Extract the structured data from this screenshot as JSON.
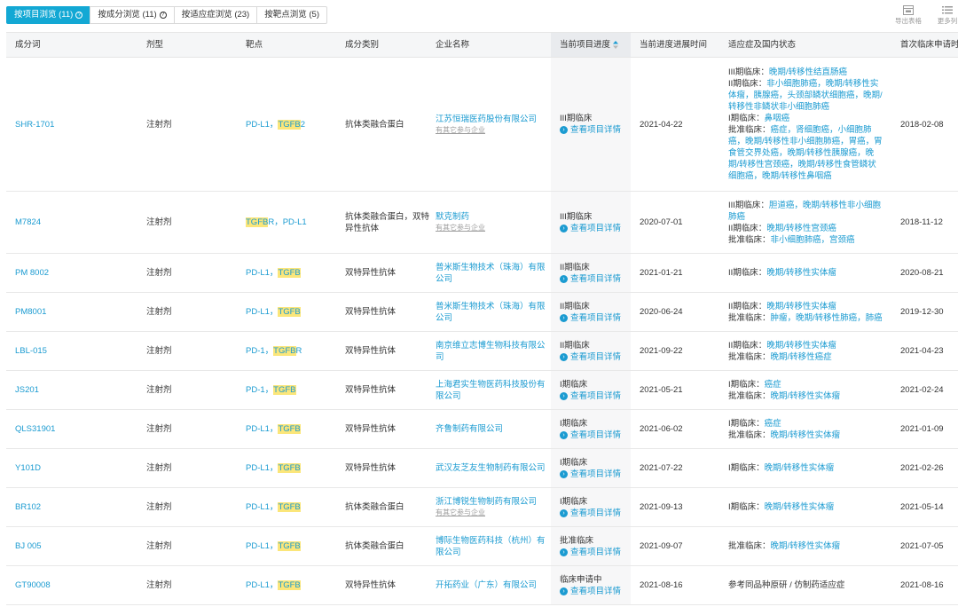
{
  "tabs": [
    {
      "label": "按项目浏览 (11)",
      "active": true,
      "help": "?"
    },
    {
      "label": "按成分浏览 (11)",
      "active": false,
      "help": "?"
    },
    {
      "label": "按适应症浏览 (23)",
      "active": false,
      "help": ""
    },
    {
      "label": "按靶点浏览 (5)",
      "active": false,
      "help": ""
    }
  ],
  "toolbar": {
    "export_label": "导出表格",
    "more_label": "更多列"
  },
  "columns": [
    "成分词",
    "剂型",
    "靶点",
    "成分类别",
    "企业名称",
    "当前项目进度",
    "当前进度进展时间",
    "适应症及国内状态",
    "首次临床申请时"
  ],
  "detail_label": "查看项目详情",
  "rows": [
    {
      "name": "SHR-1701",
      "form": "注射剂",
      "targets": [
        {
          "pre": "PD-L1，",
          "hl": "TGFB",
          "post": "2"
        }
      ],
      "category": "抗体类融合蛋白",
      "company": "江苏恒瑞医药股份有限公司",
      "company_sub": "有其它参与企业",
      "stage": "III期临床",
      "date": "2021-04-22",
      "indications": [
        {
          "label": "III期临床：",
          "value": "晚期/转移性结直肠癌"
        },
        {
          "label": "II期临床：",
          "value": "非小细胞肺癌，晚期/转移性实体瘤，胰腺癌，头颈部鳞状细胞癌，晚期/转移性非鳞状非小细胞肺癌"
        },
        {
          "label": "I期临床：",
          "value": "鼻咽癌"
        },
        {
          "label": "批准临床：",
          "value": "癌症，肾细胞癌，小细胞肺癌，晚期/转移性非小细胞肺癌，胃癌，胃食管交界处癌，晚期/转移性胰腺癌，晚期/转移性宫颈癌，晚期/转移性食管鳞状细胞癌，晚期/转移性鼻咽癌"
        }
      ],
      "first_date": "2018-02-08"
    },
    {
      "name": "M7824",
      "form": "注射剂",
      "targets": [
        {
          "pre": "",
          "hl": "TGFB",
          "post": "R，PD-L1"
        }
      ],
      "category": "抗体类融合蛋白，双特异性抗体",
      "company": "默克制药",
      "company_sub": "有其它参与企业",
      "stage": "III期临床",
      "date": "2020-07-01",
      "indications": [
        {
          "label": "III期临床：",
          "value": "胆道癌，晚期/转移性非小细胞肺癌"
        },
        {
          "label": "II期临床：",
          "value": "晚期/转移性宫颈癌"
        },
        {
          "label": "批准临床：",
          "value": "非小细胞肺癌，宫颈癌"
        }
      ],
      "first_date": "2018-11-12"
    },
    {
      "name": "PM 8002",
      "form": "注射剂",
      "targets": [
        {
          "pre": "PD-L1，",
          "hl": "TGFB",
          "post": ""
        }
      ],
      "category": "双特异性抗体",
      "company": "普米斯生物技术（珠海）有限公司",
      "company_sub": "",
      "stage": "II期临床",
      "date": "2021-01-21",
      "indications": [
        {
          "label": "II期临床：",
          "value": "晚期/转移性实体瘤"
        }
      ],
      "first_date": "2020-08-21"
    },
    {
      "name": "PM8001",
      "form": "注射剂",
      "targets": [
        {
          "pre": "PD-L1，",
          "hl": "TGFB",
          "post": ""
        }
      ],
      "category": "双特异性抗体",
      "company": "普米斯生物技术（珠海）有限公司",
      "company_sub": "",
      "stage": "II期临床",
      "date": "2020-06-24",
      "indications": [
        {
          "label": "II期临床：",
          "value": "晚期/转移性实体瘤"
        },
        {
          "label": "批准临床：",
          "value": "肿瘤，晚期/转移性肺癌，肺癌"
        }
      ],
      "first_date": "2019-12-30"
    },
    {
      "name": "LBL-015",
      "form": "注射剂",
      "targets": [
        {
          "pre": "PD-1，",
          "hl": "TGFB",
          "post": "R"
        }
      ],
      "category": "双特异性抗体",
      "company": "南京维立志博生物科技有限公司",
      "company_sub": "",
      "stage": "II期临床",
      "date": "2021-09-22",
      "indications": [
        {
          "label": "II期临床：",
          "value": "晚期/转移性实体瘤"
        },
        {
          "label": "批准临床：",
          "value": "晚期/转移性癌症"
        }
      ],
      "first_date": "2021-04-23"
    },
    {
      "name": "JS201",
      "form": "注射剂",
      "targets": [
        {
          "pre": "PD-1，",
          "hl": "TGFB",
          "post": ""
        }
      ],
      "category": "双特异性抗体",
      "company": "上海君实生物医药科技股份有限公司",
      "company_sub": "",
      "stage": "I期临床",
      "date": "2021-05-21",
      "indications": [
        {
          "label": "I期临床：",
          "value": "癌症"
        },
        {
          "label": "批准临床：",
          "value": "晚期/转移性实体瘤"
        }
      ],
      "first_date": "2021-02-24"
    },
    {
      "name": "QLS31901",
      "form": "注射剂",
      "targets": [
        {
          "pre": "PD-L1，",
          "hl": "TGFB",
          "post": ""
        }
      ],
      "category": "双特异性抗体",
      "company": "齐鲁制药有限公司",
      "company_sub": "",
      "stage": "I期临床",
      "date": "2021-06-02",
      "indications": [
        {
          "label": "I期临床：",
          "value": "癌症"
        },
        {
          "label": "批准临床：",
          "value": "晚期/转移性实体瘤"
        }
      ],
      "first_date": "2021-01-09"
    },
    {
      "name": "Y101D",
      "form": "注射剂",
      "targets": [
        {
          "pre": "PD-L1，",
          "hl": "TGFB",
          "post": ""
        }
      ],
      "category": "双特异性抗体",
      "company": "武汉友芝友生物制药有限公司",
      "company_sub": "",
      "stage": "I期临床",
      "date": "2021-07-22",
      "indications": [
        {
          "label": "I期临床：",
          "value": "晚期/转移性实体瘤"
        }
      ],
      "first_date": "2021-02-26"
    },
    {
      "name": "BR102",
      "form": "注射剂",
      "targets": [
        {
          "pre": "PD-L1，",
          "hl": "TGFB",
          "post": ""
        }
      ],
      "category": "抗体类融合蛋白",
      "company": "浙江博锐生物制药有限公司",
      "company_sub": "有其它参与企业",
      "stage": "I期临床",
      "date": "2021-09-13",
      "indications": [
        {
          "label": "I期临床：",
          "value": "晚期/转移性实体瘤"
        }
      ],
      "first_date": "2021-05-14"
    },
    {
      "name": "BJ 005",
      "form": "注射剂",
      "targets": [
        {
          "pre": "PD-L1，",
          "hl": "TGFB",
          "post": ""
        }
      ],
      "category": "抗体类融合蛋白",
      "company": "博际生物医药科技（杭州）有限公司",
      "company_sub": "",
      "stage": "批准临床",
      "date": "2021-09-07",
      "indications": [
        {
          "label": "批准临床：",
          "value": "晚期/转移性实体瘤"
        }
      ],
      "first_date": "2021-07-05"
    },
    {
      "name": "GT90008",
      "form": "注射剂",
      "targets": [
        {
          "pre": "PD-L1，",
          "hl": "TGFB",
          "post": ""
        }
      ],
      "category": "双特异性抗体",
      "company": "开拓药业（广东）有限公司",
      "company_sub": "",
      "stage": "临床申请中",
      "date": "2021-08-16",
      "indications": [
        {
          "label": "参考同品种原研 / 仿制药适应症",
          "value": ""
        }
      ],
      "first_date": "2021-08-16"
    }
  ]
}
